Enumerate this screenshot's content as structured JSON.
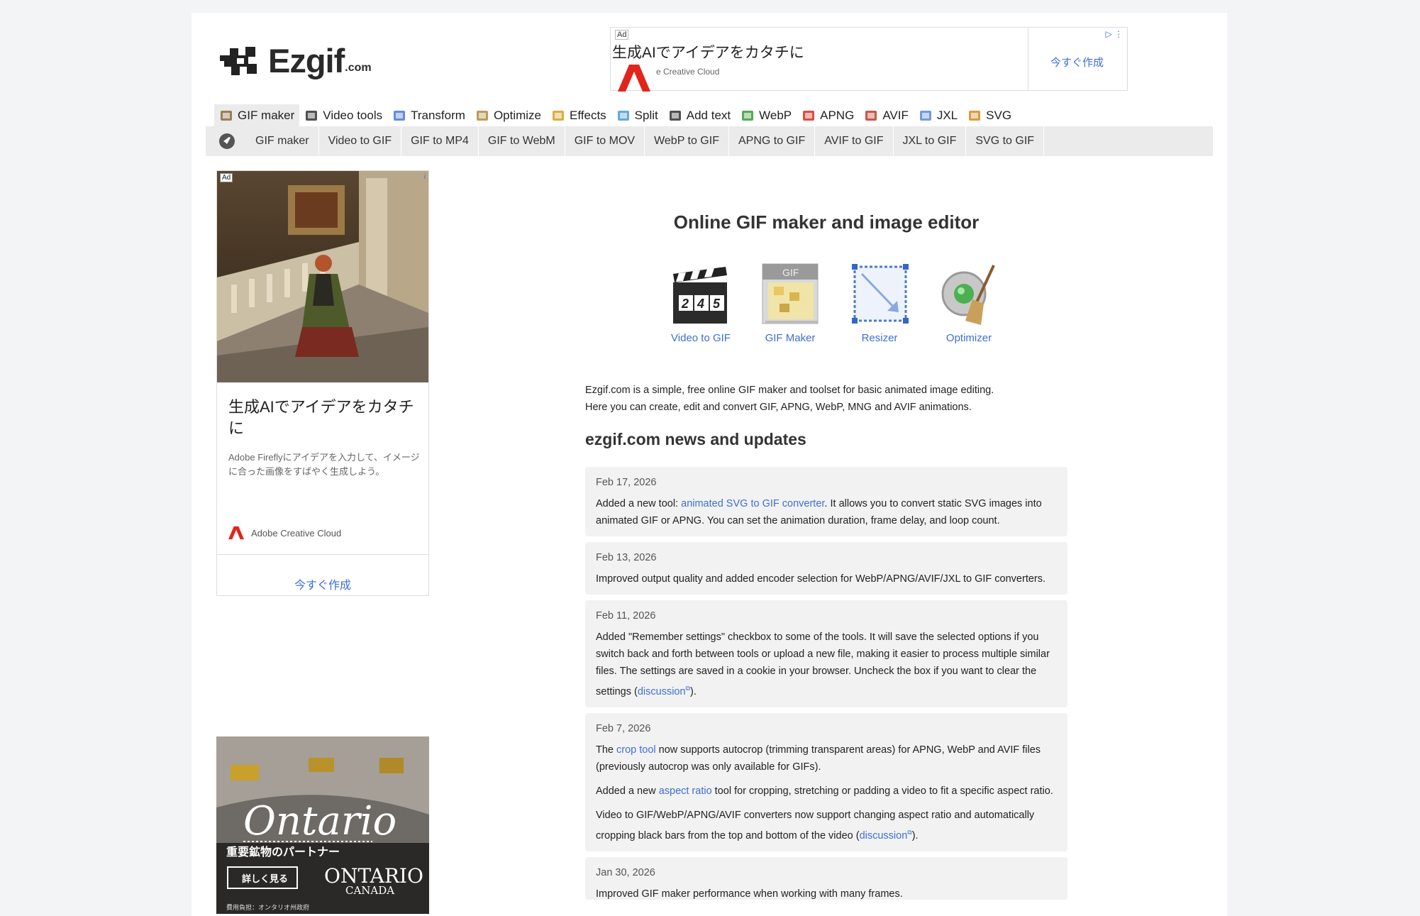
{
  "logo": {
    "name": "Ezgif",
    "suffix": ".com"
  },
  "top_ad": {
    "tag": "Ad",
    "headline": "生成AIでアイデアをカタチに",
    "sub": "e Creative Cloud",
    "cta": "今すぐ作成",
    "choice": "▷ ⋮"
  },
  "main_nav": [
    {
      "label": "GIF maker",
      "icon": "gif-maker-icon"
    },
    {
      "label": "Video tools",
      "icon": "clapper-icon"
    },
    {
      "label": "Transform",
      "icon": "crop-icon"
    },
    {
      "label": "Optimize",
      "icon": "broom-icon"
    },
    {
      "label": "Effects",
      "icon": "wand-icon"
    },
    {
      "label": "Split",
      "icon": "split-icon"
    },
    {
      "label": "Add text",
      "icon": "text-icon"
    },
    {
      "label": "WebP",
      "icon": "webp-icon"
    },
    {
      "label": "APNG",
      "icon": "apng-icon"
    },
    {
      "label": "AVIF",
      "icon": "avif-icon"
    },
    {
      "label": "JXL",
      "icon": "jxl-icon"
    },
    {
      "label": "SVG",
      "icon": "svg-icon"
    }
  ],
  "sub_nav": [
    "GIF maker",
    "Video to GIF",
    "GIF to MP4",
    "GIF to WebM",
    "GIF to MOV",
    "WebP to GIF",
    "APNG to GIF",
    "AVIF to GIF",
    "JXL to GIF",
    "SVG to GIF"
  ],
  "side_ad": {
    "tag": "Ad",
    "info": "i",
    "title": "生成AIでアイデアをカタチに",
    "desc": "Adobe Fireflyにアイデアを入力して、イメージに合った画像をすばやく生成しよう。",
    "brand": "Adobe Creative Cloud",
    "cta": "今すぐ作成"
  },
  "side_ad2": {
    "brand_script": "Ontario",
    "tagline": "重要鉱物のパートナー",
    "button": "詳しく見る",
    "logo_top": "ONTARIO",
    "logo_bottom": "CANADA",
    "footer": "費用負担：オンタリオ州政府"
  },
  "main": {
    "title": "Online GIF maker and image editor",
    "tools": [
      {
        "label": "Video to GIF",
        "icon": "clapperboard-icon"
      },
      {
        "label": "GIF Maker",
        "icon": "gif-file-icon"
      },
      {
        "label": "Resizer",
        "icon": "resize-icon"
      },
      {
        "label": "Optimizer",
        "icon": "gear-broom-icon"
      }
    ],
    "intro_1": "Ezgif.com is a simple, free online GIF maker and toolset for basic animated image editing.",
    "intro_2": "Here you can create, edit and convert GIF, APNG, WebP, MNG and AVIF animations.",
    "news_title": "ezgif.com news and updates"
  },
  "news": [
    {
      "date": "Feb 17, 2026",
      "p1_pre": "Added a new tool: ",
      "p1_link": "animated SVG to GIF converter",
      "p1_post": ". It allows you to convert static SVG images into animated GIF or APNG. You can set the animation duration, frame delay, and loop count."
    },
    {
      "date": "Feb 13, 2026",
      "p1": "Improved output quality and added encoder selection for WebP/APNG/AVIF/JXL to GIF converters."
    },
    {
      "date": "Feb 11, 2026",
      "p1_pre": "Added \"Remember settings\" checkbox to some of the tools. It will save the selected options if you switch back and forth between tools or upload a new file, making it easier to process multiple similar files. The settings are saved in a cookie in your browser. Uncheck the box if you want to clear the settings (",
      "p1_link": "discussion",
      "p1_post": ")."
    },
    {
      "date": "Feb 7, 2026",
      "p1_pre": "The ",
      "p1_link": "crop tool",
      "p1_post": " now supports autocrop (trimming transparent areas) for APNG, WebP and AVIF files (previously autocrop was only available for GIFs).",
      "p2_pre": "Added a new ",
      "p2_link": "aspect ratio",
      "p2_post": " tool for cropping, stretching or padding a video to fit a specific aspect ratio.",
      "p3_pre": "Video to GIF/WebP/APNG/AVIF converters now support changing aspect ratio and automatically cropping black bars from the top and bottom of the video (",
      "p3_link": "discussion",
      "p3_post": ")."
    },
    {
      "date": "Jan 30, 2026",
      "p1": "Improved GIF maker performance when working with many frames."
    }
  ],
  "colors": {
    "link": "#3d6fd6",
    "nav_bg": "#ebebeb",
    "news_bg": "#f2f2f2"
  }
}
